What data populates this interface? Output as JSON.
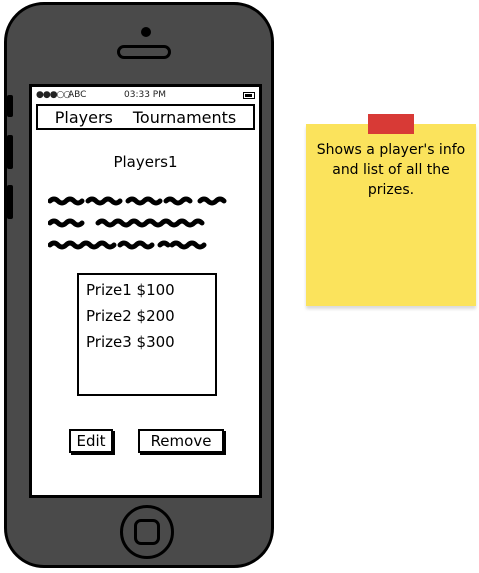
{
  "status_bar": {
    "signal": "●●●○○",
    "carrier": "ABC",
    "time": "03:33 PM"
  },
  "tabs": [
    {
      "label": "Players"
    },
    {
      "label": "Tournaments"
    }
  ],
  "player": {
    "title": "Players1"
  },
  "prizes": [
    {
      "label": "Prize1 $100"
    },
    {
      "label": "Prize2 $200"
    },
    {
      "label": "Prize3 $300"
    }
  ],
  "actions": {
    "edit_label": "Edit",
    "remove_label": "Remove"
  },
  "note": {
    "text": "Shows a player's info and list of all the prizes."
  },
  "colors": {
    "note": "#fbe35c",
    "tape": "#d83a36",
    "phone_body": "#4a4a4a"
  }
}
